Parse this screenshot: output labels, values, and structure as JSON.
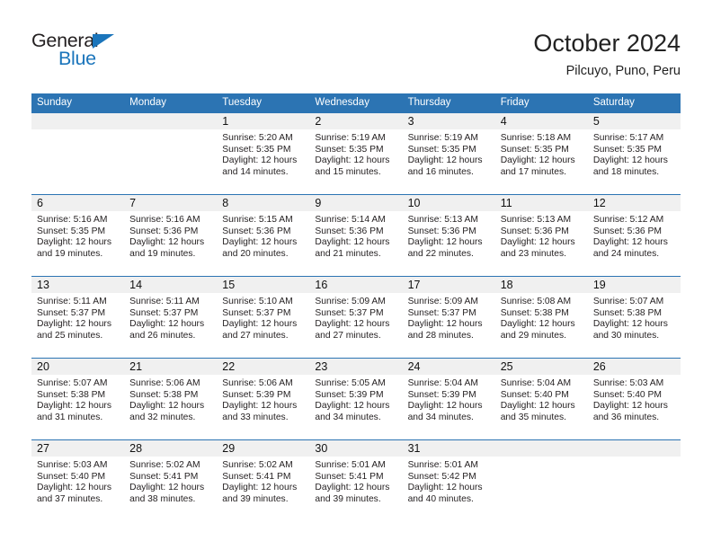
{
  "brand": {
    "name_top": "General",
    "name_bottom": "Blue",
    "triangle_icon": "logo-triangle-icon",
    "color_blue": "#1b75bb",
    "color_dark": "#231f20"
  },
  "header": {
    "title": "October 2024",
    "subtitle": "Pilcuyo, Puno, Peru"
  },
  "theme": {
    "header_row_bg": "#2c74b3",
    "daynum_band_bg": "#f0f0f0",
    "row_divider": "#2c74b3",
    "text": "#231f20"
  },
  "weekday_headers": [
    "Sunday",
    "Monday",
    "Tuesday",
    "Wednesday",
    "Thursday",
    "Friday",
    "Saturday"
  ],
  "labels": {
    "sunrise_prefix": "Sunrise:",
    "sunset_prefix": "Sunset:",
    "daylight_prefix": "Daylight:"
  },
  "weeks": [
    [
      {
        "day": "",
        "sunrise": "",
        "sunset": "",
        "daylight": "",
        "blank": true
      },
      {
        "day": "",
        "sunrise": "",
        "sunset": "",
        "daylight": "",
        "blank": true
      },
      {
        "day": "1",
        "sunrise": "Sunrise: 5:20 AM",
        "sunset": "Sunset: 5:35 PM",
        "daylight": "Daylight: 12 hours and 14 minutes."
      },
      {
        "day": "2",
        "sunrise": "Sunrise: 5:19 AM",
        "sunset": "Sunset: 5:35 PM",
        "daylight": "Daylight: 12 hours and 15 minutes."
      },
      {
        "day": "3",
        "sunrise": "Sunrise: 5:19 AM",
        "sunset": "Sunset: 5:35 PM",
        "daylight": "Daylight: 12 hours and 16 minutes."
      },
      {
        "day": "4",
        "sunrise": "Sunrise: 5:18 AM",
        "sunset": "Sunset: 5:35 PM",
        "daylight": "Daylight: 12 hours and 17 minutes."
      },
      {
        "day": "5",
        "sunrise": "Sunrise: 5:17 AM",
        "sunset": "Sunset: 5:35 PM",
        "daylight": "Daylight: 12 hours and 18 minutes."
      }
    ],
    [
      {
        "day": "6",
        "sunrise": "Sunrise: 5:16 AM",
        "sunset": "Sunset: 5:35 PM",
        "daylight": "Daylight: 12 hours and 19 minutes."
      },
      {
        "day": "7",
        "sunrise": "Sunrise: 5:16 AM",
        "sunset": "Sunset: 5:36 PM",
        "daylight": "Daylight: 12 hours and 19 minutes."
      },
      {
        "day": "8",
        "sunrise": "Sunrise: 5:15 AM",
        "sunset": "Sunset: 5:36 PM",
        "daylight": "Daylight: 12 hours and 20 minutes."
      },
      {
        "day": "9",
        "sunrise": "Sunrise: 5:14 AM",
        "sunset": "Sunset: 5:36 PM",
        "daylight": "Daylight: 12 hours and 21 minutes."
      },
      {
        "day": "10",
        "sunrise": "Sunrise: 5:13 AM",
        "sunset": "Sunset: 5:36 PM",
        "daylight": "Daylight: 12 hours and 22 minutes."
      },
      {
        "day": "11",
        "sunrise": "Sunrise: 5:13 AM",
        "sunset": "Sunset: 5:36 PM",
        "daylight": "Daylight: 12 hours and 23 minutes."
      },
      {
        "day": "12",
        "sunrise": "Sunrise: 5:12 AM",
        "sunset": "Sunset: 5:36 PM",
        "daylight": "Daylight: 12 hours and 24 minutes."
      }
    ],
    [
      {
        "day": "13",
        "sunrise": "Sunrise: 5:11 AM",
        "sunset": "Sunset: 5:37 PM",
        "daylight": "Daylight: 12 hours and 25 minutes."
      },
      {
        "day": "14",
        "sunrise": "Sunrise: 5:11 AM",
        "sunset": "Sunset: 5:37 PM",
        "daylight": "Daylight: 12 hours and 26 minutes."
      },
      {
        "day": "15",
        "sunrise": "Sunrise: 5:10 AM",
        "sunset": "Sunset: 5:37 PM",
        "daylight": "Daylight: 12 hours and 27 minutes."
      },
      {
        "day": "16",
        "sunrise": "Sunrise: 5:09 AM",
        "sunset": "Sunset: 5:37 PM",
        "daylight": "Daylight: 12 hours and 27 minutes."
      },
      {
        "day": "17",
        "sunrise": "Sunrise: 5:09 AM",
        "sunset": "Sunset: 5:37 PM",
        "daylight": "Daylight: 12 hours and 28 minutes."
      },
      {
        "day": "18",
        "sunrise": "Sunrise: 5:08 AM",
        "sunset": "Sunset: 5:38 PM",
        "daylight": "Daylight: 12 hours and 29 minutes."
      },
      {
        "day": "19",
        "sunrise": "Sunrise: 5:07 AM",
        "sunset": "Sunset: 5:38 PM",
        "daylight": "Daylight: 12 hours and 30 minutes."
      }
    ],
    [
      {
        "day": "20",
        "sunrise": "Sunrise: 5:07 AM",
        "sunset": "Sunset: 5:38 PM",
        "daylight": "Daylight: 12 hours and 31 minutes."
      },
      {
        "day": "21",
        "sunrise": "Sunrise: 5:06 AM",
        "sunset": "Sunset: 5:38 PM",
        "daylight": "Daylight: 12 hours and 32 minutes."
      },
      {
        "day": "22",
        "sunrise": "Sunrise: 5:06 AM",
        "sunset": "Sunset: 5:39 PM",
        "daylight": "Daylight: 12 hours and 33 minutes."
      },
      {
        "day": "23",
        "sunrise": "Sunrise: 5:05 AM",
        "sunset": "Sunset: 5:39 PM",
        "daylight": "Daylight: 12 hours and 34 minutes."
      },
      {
        "day": "24",
        "sunrise": "Sunrise: 5:04 AM",
        "sunset": "Sunset: 5:39 PM",
        "daylight": "Daylight: 12 hours and 34 minutes."
      },
      {
        "day": "25",
        "sunrise": "Sunrise: 5:04 AM",
        "sunset": "Sunset: 5:40 PM",
        "daylight": "Daylight: 12 hours and 35 minutes."
      },
      {
        "day": "26",
        "sunrise": "Sunrise: 5:03 AM",
        "sunset": "Sunset: 5:40 PM",
        "daylight": "Daylight: 12 hours and 36 minutes."
      }
    ],
    [
      {
        "day": "27",
        "sunrise": "Sunrise: 5:03 AM",
        "sunset": "Sunset: 5:40 PM",
        "daylight": "Daylight: 12 hours and 37 minutes."
      },
      {
        "day": "28",
        "sunrise": "Sunrise: 5:02 AM",
        "sunset": "Sunset: 5:41 PM",
        "daylight": "Daylight: 12 hours and 38 minutes."
      },
      {
        "day": "29",
        "sunrise": "Sunrise: 5:02 AM",
        "sunset": "Sunset: 5:41 PM",
        "daylight": "Daylight: 12 hours and 39 minutes."
      },
      {
        "day": "30",
        "sunrise": "Sunrise: 5:01 AM",
        "sunset": "Sunset: 5:41 PM",
        "daylight": "Daylight: 12 hours and 39 minutes."
      },
      {
        "day": "31",
        "sunrise": "Sunrise: 5:01 AM",
        "sunset": "Sunset: 5:42 PM",
        "daylight": "Daylight: 12 hours and 40 minutes."
      },
      {
        "day": "",
        "sunrise": "",
        "sunset": "",
        "daylight": "",
        "blank": true
      },
      {
        "day": "",
        "sunrise": "",
        "sunset": "",
        "daylight": "",
        "blank": true
      }
    ]
  ]
}
